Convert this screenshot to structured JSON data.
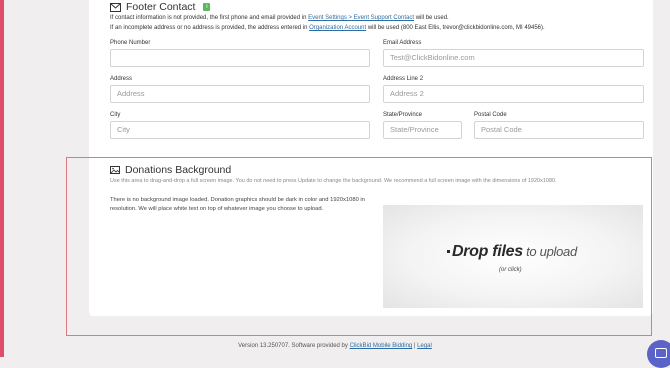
{
  "footer_contact": {
    "title": "Footer Contact",
    "badge": "i",
    "info_line1_pre": "If contact information is not provided, the first phone and email provided in ",
    "info_line1_link": "Event Settings > Event Support Contact",
    "info_line1_post": " will be used.",
    "info_line2_pre": "If an incomplete address or no address is provided, the address entered in ",
    "info_line2_link": "Organization Account",
    "info_line2_post": " will be used (800 East Ellis, trevor@clickbidonline.com, MI 49456).",
    "fields": {
      "phone_label": "Phone Number",
      "phone_placeholder": "",
      "email_label": "Email Address",
      "email_placeholder": "Test@ClickBidonline.com",
      "address_label": "Address",
      "address_placeholder": "Address",
      "address2_label": "Address Line 2",
      "address2_placeholder": "Address 2",
      "city_label": "City",
      "city_placeholder": "City",
      "state_label": "State/Province",
      "state_placeholder": "State/Province",
      "postal_label": "Postal Code",
      "postal_placeholder": "Postal Code"
    }
  },
  "donations_background": {
    "title": "Donations Background",
    "description": "Use this area to drag-and-drop a full screen image. You do not need to press Update to change the background. We recommend a full screen image with the dimensions of 1920x1080.",
    "status_text": "There is no background image loaded. Donation graphics should be dark in color and 1920x1080 in resolution. We will place white text on top of whatever image you choose to upload.",
    "dropzone_main": "Drop files",
    "dropzone_tail": " to upload",
    "dropzone_sub": "(or click)"
  },
  "footer": {
    "version_text": "Version 13.250707. Software provided by ",
    "provider_link": "ClickBid Mobile Bidding",
    "separator": " | ",
    "legal_link": "Legal"
  },
  "colors": {
    "accent_link": "#2e6da4",
    "badge_green": "#5cb85c",
    "frame_red": "#d87b85",
    "chat_button": "#5b63c9"
  }
}
